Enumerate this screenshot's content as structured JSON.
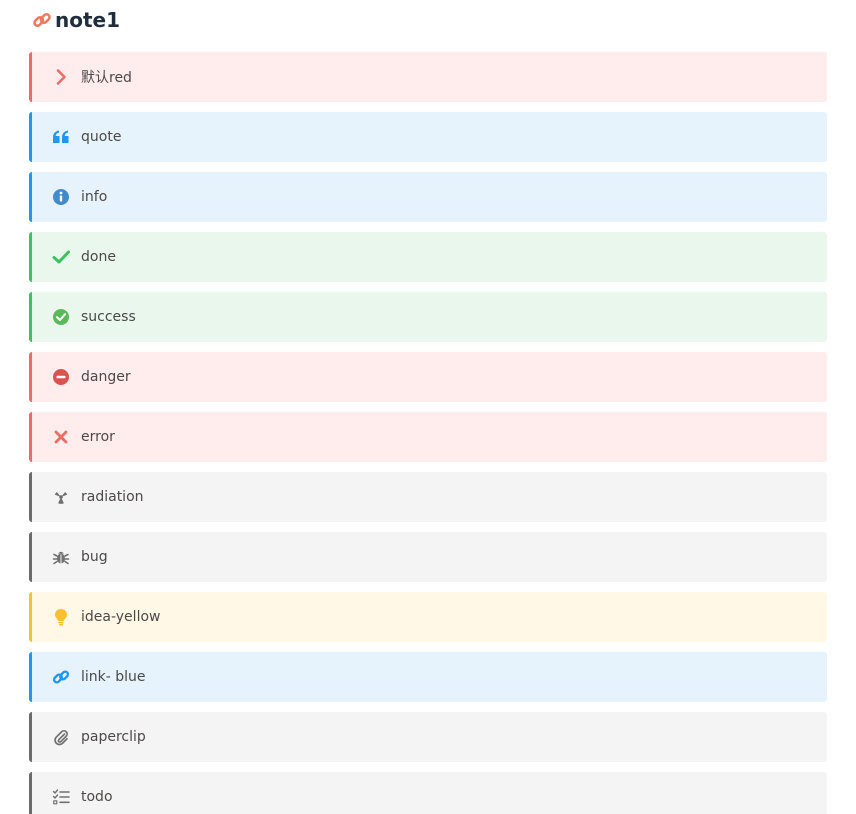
{
  "heading": {
    "title": "note1",
    "icon": "link-icon",
    "icon_color": "#f0785f"
  },
  "notes": [
    {
      "label": "默认red",
      "icon": "chevron-right-icon",
      "color": "#ef6b65"
    },
    {
      "label": "quote",
      "icon": "quote-left-icon",
      "color": "#2196f3"
    },
    {
      "label": "info",
      "icon": "info-circle-icon",
      "color": "#428bca"
    },
    {
      "label": "done",
      "icon": "check-icon",
      "color": "#3dc35e"
    },
    {
      "label": "success",
      "icon": "check-circle-icon",
      "color": "#5cb85c"
    },
    {
      "label": "danger",
      "icon": "minus-circle-icon",
      "color": "#d9534f"
    },
    {
      "label": "error",
      "icon": "times-icon",
      "color": "#ef6b65"
    },
    {
      "label": "radiation",
      "icon": "radiation-icon",
      "color": "#707070"
    },
    {
      "label": "bug",
      "icon": "bug-icon",
      "color": "#707070"
    },
    {
      "label": "idea-yellow",
      "icon": "lightbulb-icon",
      "color": "#fbc02d"
    },
    {
      "label": "link- blue",
      "icon": "link-icon",
      "color": "#2196f3"
    },
    {
      "label": "paperclip",
      "icon": "paperclip-icon",
      "color": "#707070"
    },
    {
      "label": "todo",
      "icon": "tasks-icon",
      "color": "#707070"
    }
  ]
}
